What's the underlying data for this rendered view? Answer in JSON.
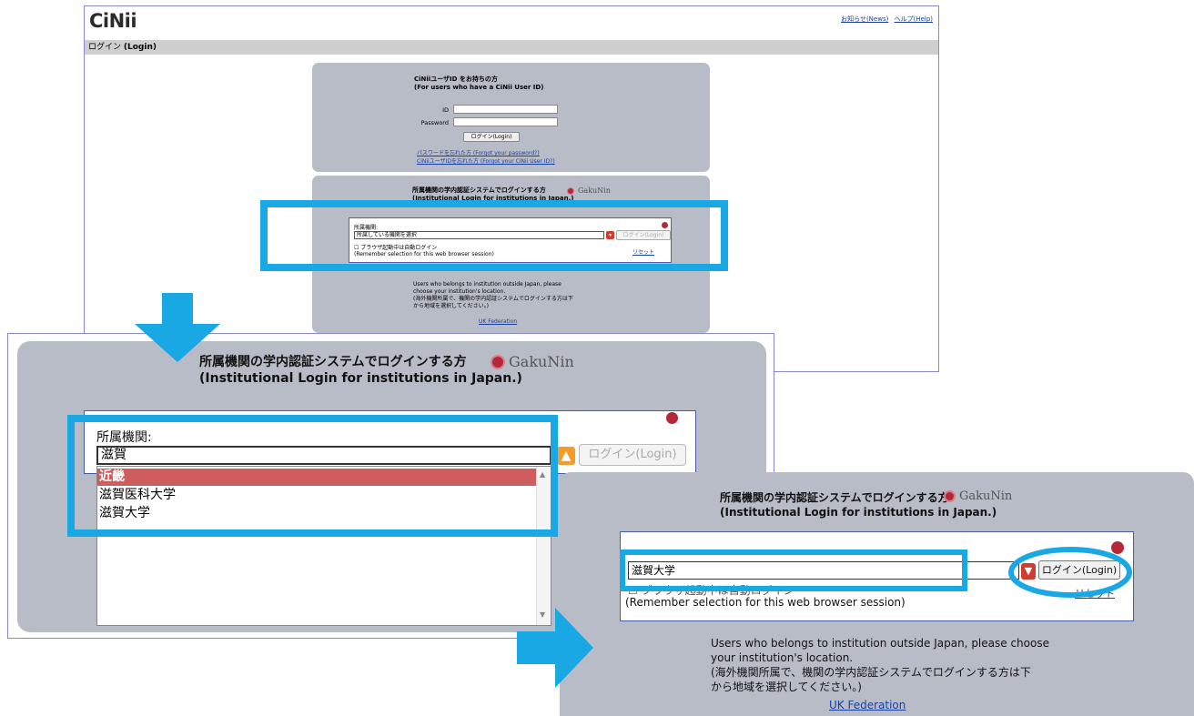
{
  "screen1": {
    "logo": "CiNii",
    "top_links": [
      "お知らせ(News)",
      "ヘルプ(Help)"
    ],
    "login_bar": {
      "ja": "ログイン",
      "en": "(Login)"
    },
    "ciniid_section": {
      "title_ja": "CiNiiユーザID をお持ちの方",
      "title_en": "(For users who have a CiNii User ID)",
      "id_label": "ID",
      "password_label": "Password",
      "login_button": "ログイン(Login)",
      "forgot_password": "パスワードを忘れた方 (Forgot your password?)",
      "forgot_id": "CiNiiユーザIDを忘れた方 (Forgot your CiNii User ID?)"
    },
    "institution_section": {
      "title_ja": "所属機関の学内認証システムでログインする方",
      "title_en": "(Institutional Login for institutions in Japan.)",
      "gakunin": "GakuNin",
      "aff_label": "所属機関:",
      "select_placeholder": "所属している機関を選択",
      "login_button": "ログイン(Login)",
      "remember_ja": "ブラウザ起動中は自動ログイン",
      "remember_en": "(Remember selection for this web browser session)",
      "reset": "リセット",
      "outside_en": "Users who belongs to institution outside Japan, please choose your institution's location.",
      "outside_ja": "(海外機関所属で、機関の学内認証システムでログインする方は下から地域を選択してください。)",
      "uk_federation": "UK Federation"
    }
  },
  "screen2": {
    "title_ja": "所属機関の学内認証システムでログインする方",
    "title_en": "(Institutional Login for institutions in Japan.)",
    "gakunin": "GakuNin",
    "aff_label": "所属機関:",
    "search_value": "滋賀",
    "login_button": "ログイン(Login)",
    "dropdown_items": [
      "近畿",
      "滋賀医科大学",
      "滋賀大学"
    ]
  },
  "screen3": {
    "title_ja": "所属機関の学内認証システムでログインする方",
    "title_en": "(Institutional Login for institutions in Japan.)",
    "gakunin": "GakuNin",
    "selected_value": "滋賀大学",
    "login_button": "ログイン(Login)",
    "remember_ja": "ブラウザ起動中は自動ログイン",
    "remember_en": "(Remember selection for this web browser session)",
    "reset": "リセット",
    "outside_en_1": "Users who belongs to institution outside Japan, please choose",
    "outside_en_2": "your institution's location.",
    "outside_ja_1": "(海外機関所属で、機関の学内認証システムでログインする方は下",
    "outside_ja_2": "から地域を選択してください。)",
    "uk_federation": "UK Federation"
  },
  "colors": {
    "highlight": "#1aa8e4",
    "panel": "#b8bcc7",
    "selected_item": "#d05d5d",
    "gakunin_red": "#b5283a",
    "orange_arrow": "#f59b2a"
  }
}
